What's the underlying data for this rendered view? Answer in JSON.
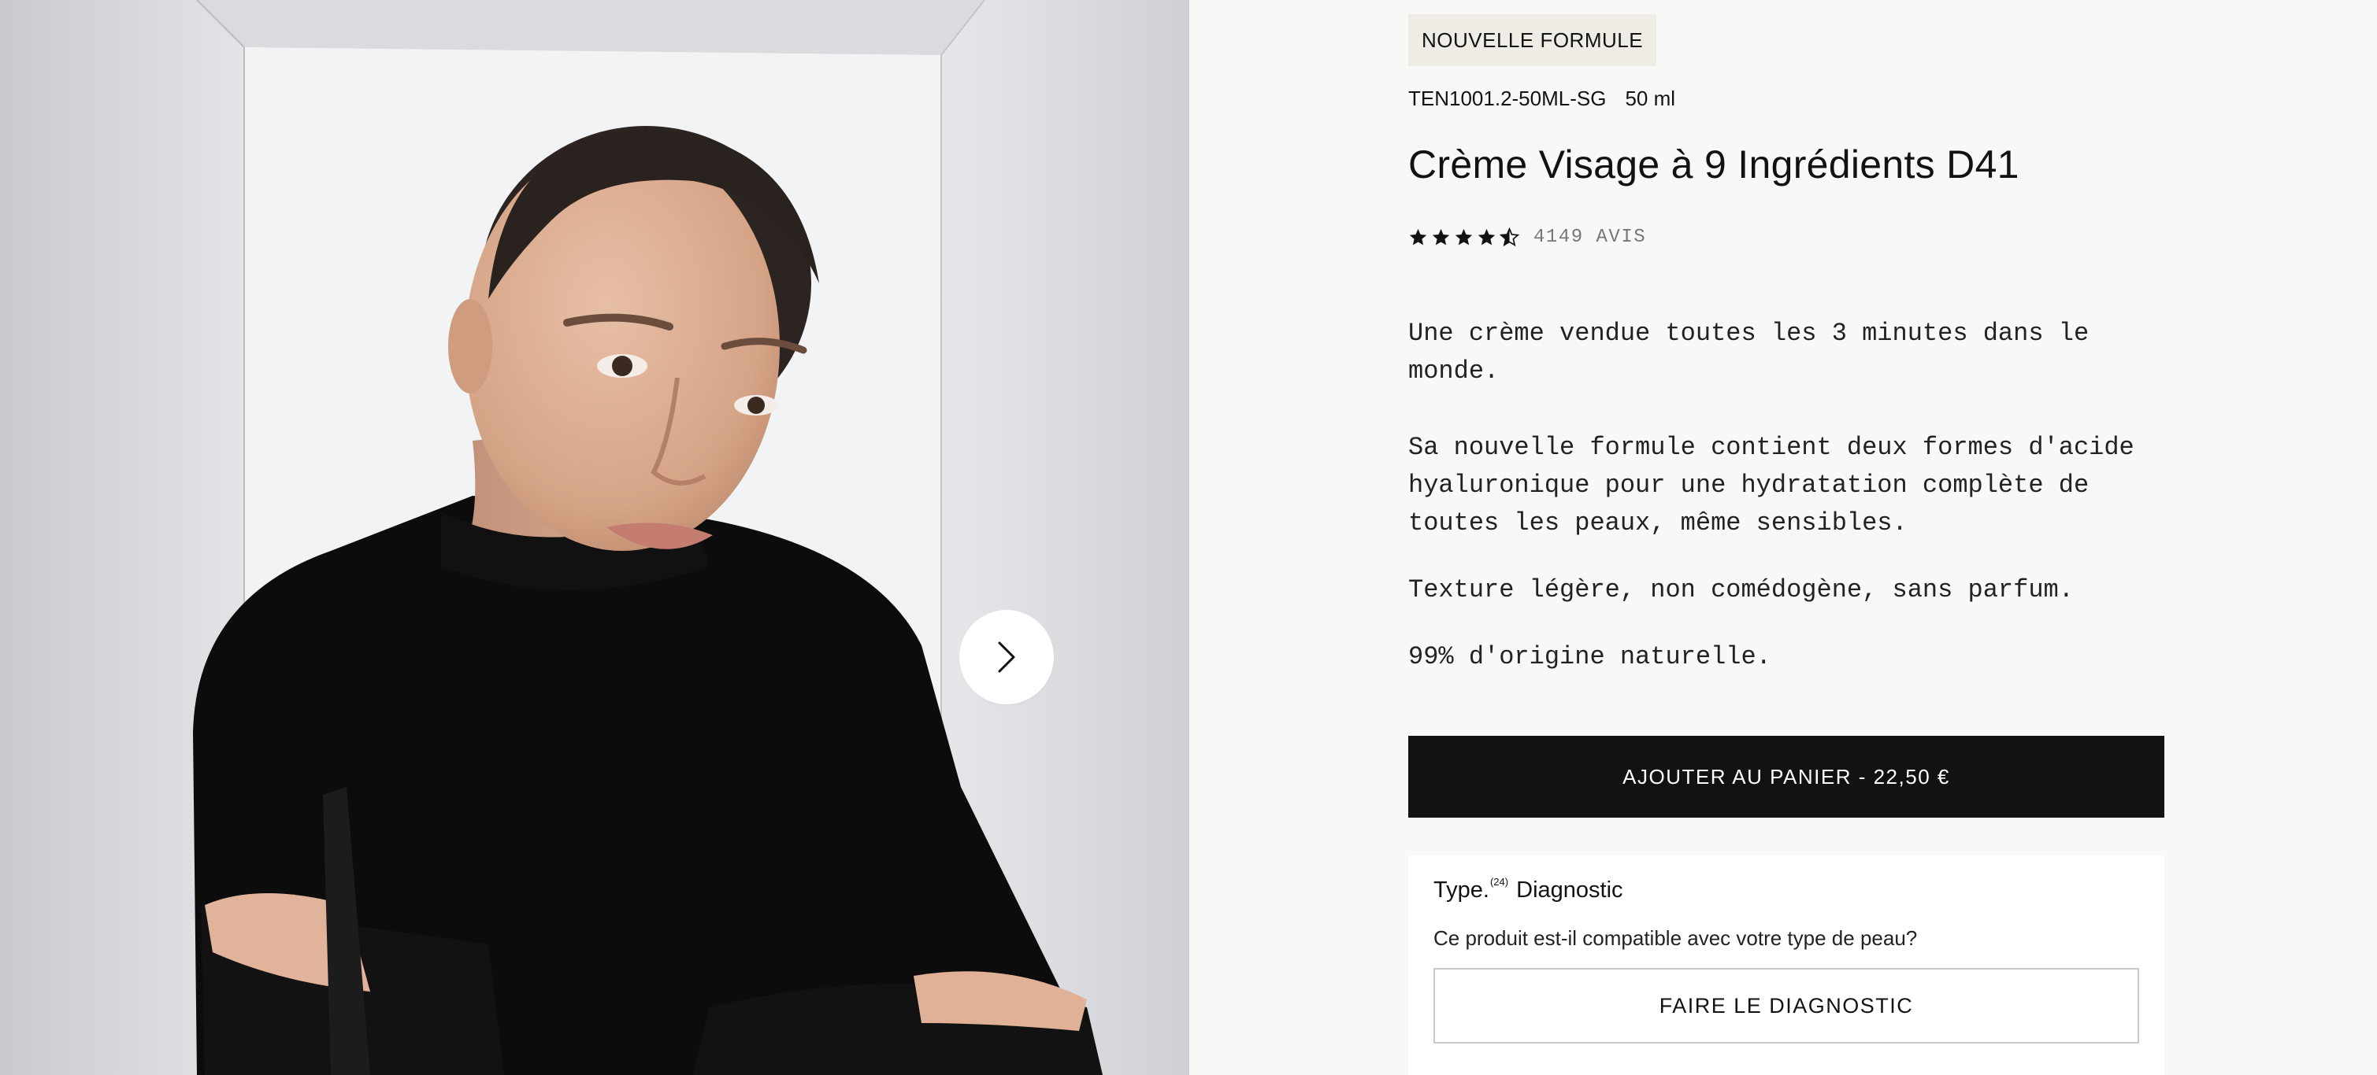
{
  "product": {
    "badge": "NOUVELLE FORMULE",
    "sku": "TEN1001.2-50ML-SG",
    "size": "50 ml",
    "title": "Crème Visage à 9 Ingrédients D41",
    "rating": 4.5,
    "reviews_label": "4149 AVIS",
    "description": [
      "Une crème vendue toutes les 3 minutes dans le monde.",
      "Sa nouvelle formule contient deux formes d'acide hyaluronique pour une hydratation complète de toutes les peaux, même sensibles.",
      "Texture légère, non comédogène, sans parfum.",
      "99% d'origine naturelle."
    ],
    "add_to_cart_label": "AJOUTER AU PANIER - 22,50 €"
  },
  "diagnostic": {
    "brand": "Type.",
    "brand_sup": "(24)",
    "title": "Diagnostic",
    "question": "Ce produit est-il compatible avec votre type de peau?",
    "button_label": "FAIRE LE DIAGNOSTIC"
  },
  "gallery": {
    "next_icon": "chevron-right-icon"
  },
  "colors": {
    "page_bg": "#f9f8f6",
    "cta_bg": "#121212",
    "badge_bg": "#efece6"
  }
}
